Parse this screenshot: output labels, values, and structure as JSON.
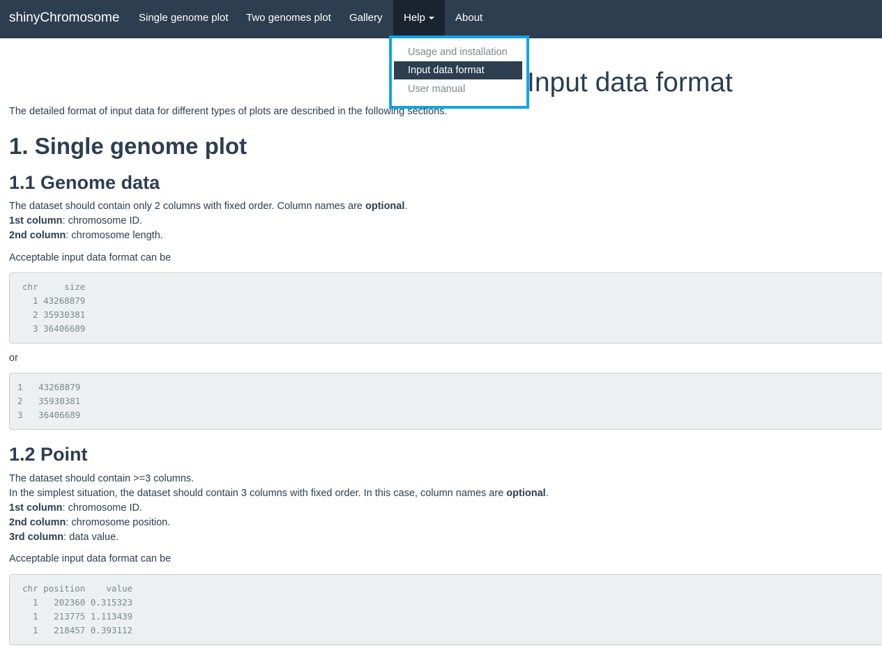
{
  "navbar": {
    "brand": "shinyChromosome",
    "items": [
      {
        "label": "Single genome plot"
      },
      {
        "label": "Two genomes plot"
      },
      {
        "label": "Gallery"
      },
      {
        "label": "Help"
      },
      {
        "label": "About"
      }
    ]
  },
  "help_dropdown": {
    "items": [
      {
        "label": "Usage and installation"
      },
      {
        "label": "Input data format",
        "active": true
      },
      {
        "label": "User manual"
      }
    ]
  },
  "content": {
    "title": "Input data format",
    "intro": "The detailed format of input data for different types of plots are described in the following sections.",
    "section1": {
      "heading": "1. Single genome plot"
    },
    "genome": {
      "heading": "1.1 Genome data",
      "desc_pre": "The dataset should contain only 2 columns with fixed order. Column names are ",
      "desc_bold": "optional",
      "desc_post": ".",
      "col1_label": "1st column",
      "col1_text": ": chromosome ID.",
      "col2_label": "2nd column",
      "col2_text": ": chromosome length.",
      "acceptable": "Acceptable input data format can be",
      "code1": "chr     size\n  1 43268879\n  2 35930381\n  3 36406689",
      "or": "or",
      "code2": "1   43268879\n2   35930381\n3   36406689"
    },
    "point": {
      "heading": "1.2 Point",
      "line1": "The dataset should contain >=3 columns.",
      "line2_pre": "In the simplest situation, the dataset should contain 3 columns with fixed order. In this case, column names are ",
      "line2_bold": "optional",
      "line2_post": ".",
      "col1_label": "1st column",
      "col1_text": ": chromosome ID.",
      "col2_label": "2nd column",
      "col2_text": ": chromosome position.",
      "col3_label": "3rd column",
      "col3_text": ": data value.",
      "acceptable": "Acceptable input data format can be",
      "code": "chr position    value\n  1   202360 0.315323\n  1   213775 1.113439\n  1   218457 0.393112"
    }
  }
}
